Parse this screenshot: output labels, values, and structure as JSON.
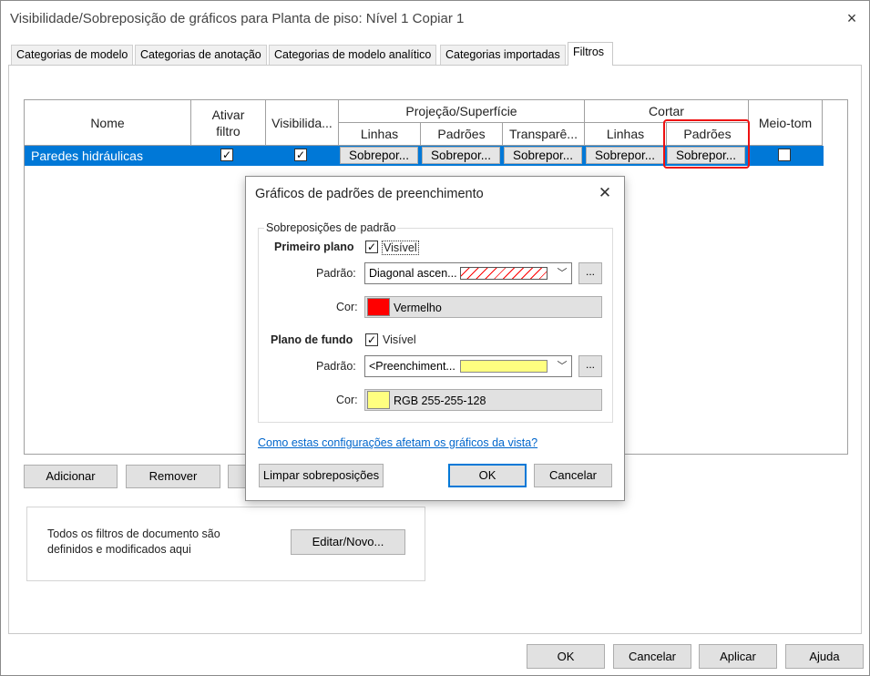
{
  "window": {
    "title": "Visibilidade/Sobreposição de gráficos para Planta de piso: Nível 1 Copiar 1",
    "close_icon": "×"
  },
  "tabs": [
    {
      "label": "Categorias de modelo"
    },
    {
      "label": "Categorias de anotação"
    },
    {
      "label": "Categorias de modelo analítico"
    },
    {
      "label": "Categorias importadas"
    },
    {
      "label": "Filtros",
      "active": true
    }
  ],
  "grid": {
    "headers": {
      "nome": "Nome",
      "ativar_filtro": "Ativar\nfiltro",
      "visibilidade": "Visibilida...",
      "projecao": "Projeção/Superfície",
      "cortar": "Cortar",
      "linhas": "Linhas",
      "padroes": "Padrões",
      "transparencia": "Transparê...",
      "cortar_linhas": "Linhas",
      "cortar_padroes": "Padrões",
      "meio_tom": "Meio-tom"
    },
    "row": {
      "name": "Paredes hidráulicas",
      "ativar": true,
      "visivel": true,
      "meio_tom": false,
      "override_label": "Sobrepor..."
    }
  },
  "buttons": {
    "adicionar": "Adicionar",
    "remover": "Remover",
    "editar_novo": "Editar/Novo...",
    "ok": "OK",
    "cancelar": "Cancelar",
    "aplicar": "Aplicar",
    "ajuda": "Ajuda"
  },
  "info_text_1": "Todos os filtros de documento são",
  "info_text_2": "definidos e modificados aqui",
  "dialog": {
    "title": "Gráficos de padrões de preenchimento",
    "close_icon": "✕",
    "group_title": "Sobreposições de padrão",
    "foreground": {
      "label": "Primeiro plano",
      "visible_label": "Visível",
      "visible": true,
      "pattern_label": "Padrão:",
      "pattern_value": "Diagonal ascen...",
      "color_label": "Cor:",
      "color_name": "Vermelho",
      "color_hex": "#ff0000"
    },
    "background": {
      "label": "Plano de fundo",
      "visible_label": "Visível",
      "visible": true,
      "pattern_label": "Padrão:",
      "pattern_value": "<Preenchiment...",
      "color_label": "Cor:",
      "color_name": "RGB 255-255-128",
      "color_hex": "#ffff80"
    },
    "dots_label": "...",
    "link": "Como estas configurações afetam os gráficos da vista?",
    "clear_button": "Limpar sobreposições",
    "ok_button": "OK",
    "cancel_button": "Cancelar"
  },
  "colors": {
    "selection": "#0078d7",
    "highlight_border": "#ee1111",
    "link": "#0066cc"
  }
}
